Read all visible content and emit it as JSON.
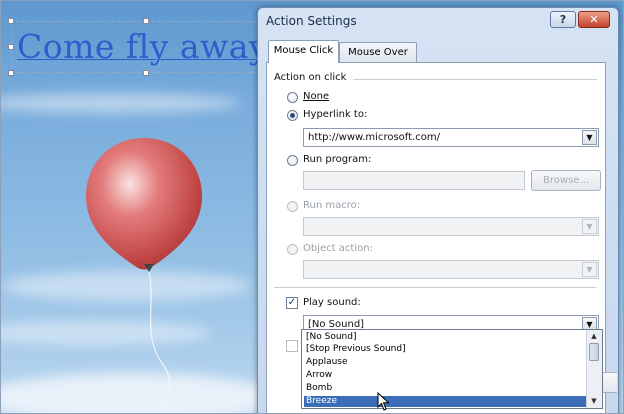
{
  "slide": {
    "title_text": "Come fly away"
  },
  "dialog": {
    "title": "Action Settings",
    "help_glyph": "?",
    "close_glyph": "✕",
    "tabs": [
      {
        "label": "Mouse Click",
        "active": true
      },
      {
        "label": "Mouse Over",
        "active": false
      }
    ],
    "group_label": "Action on click",
    "options": {
      "none": {
        "label": "None",
        "checked": false
      },
      "hyperlink": {
        "label": "Hyperlink to:",
        "checked": true,
        "value": "http://www.microsoft.com/"
      },
      "run_program": {
        "label": "Run program:",
        "checked": false,
        "value": "",
        "browse_label": "Browse..."
      },
      "run_macro": {
        "label": "Run macro:",
        "checked": false,
        "enabled": false,
        "value": ""
      },
      "object_action": {
        "label": "Object action:",
        "checked": false,
        "enabled": false,
        "value": ""
      }
    },
    "play_sound": {
      "label": "Play sound:",
      "checked": true,
      "value": "[No Sound]"
    },
    "check_mark": "✓",
    "sound_list": {
      "items": [
        "[No Sound]",
        "[Stop Previous Sound]",
        "Applause",
        "Arrow",
        "Bomb",
        "Breeze"
      ],
      "selected": "Breeze"
    },
    "dropdown_glyph": "▼",
    "scroll_up_glyph": "▲",
    "scroll_down_glyph": "▼"
  },
  "colors": {
    "title_text": "#2b5fcc",
    "selection": "#3a6fb8",
    "balloon": "#d85b5b"
  }
}
